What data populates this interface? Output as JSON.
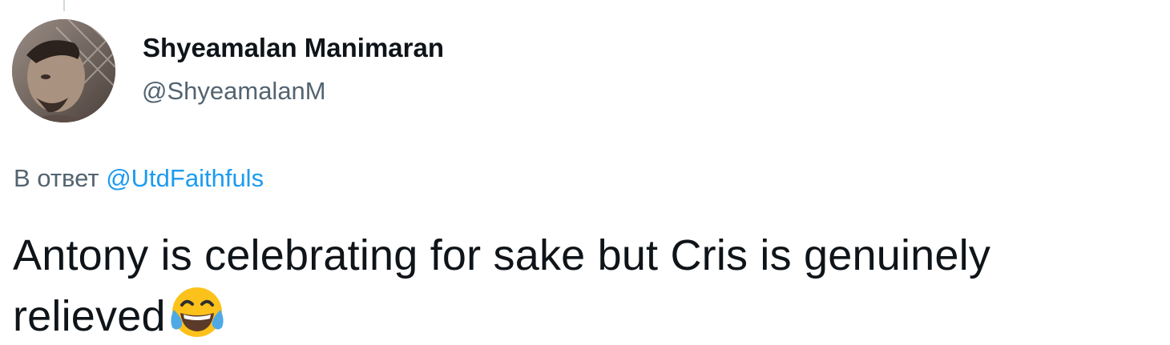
{
  "tweet": {
    "author_name": "Shyeamalan Manimaran",
    "author_handle": "@ShyeamalanM",
    "reply_prefix": "В ответ ",
    "reply_mention": "@UtdFaithfuls",
    "text": "Antony is celebrating for sake but Cris is genuinely relieved",
    "emoji": "face-with-tears-of-joy-icon"
  },
  "colors": {
    "text_primary": "#0f1419",
    "text_secondary": "#536471",
    "link": "#1d9bf0"
  }
}
